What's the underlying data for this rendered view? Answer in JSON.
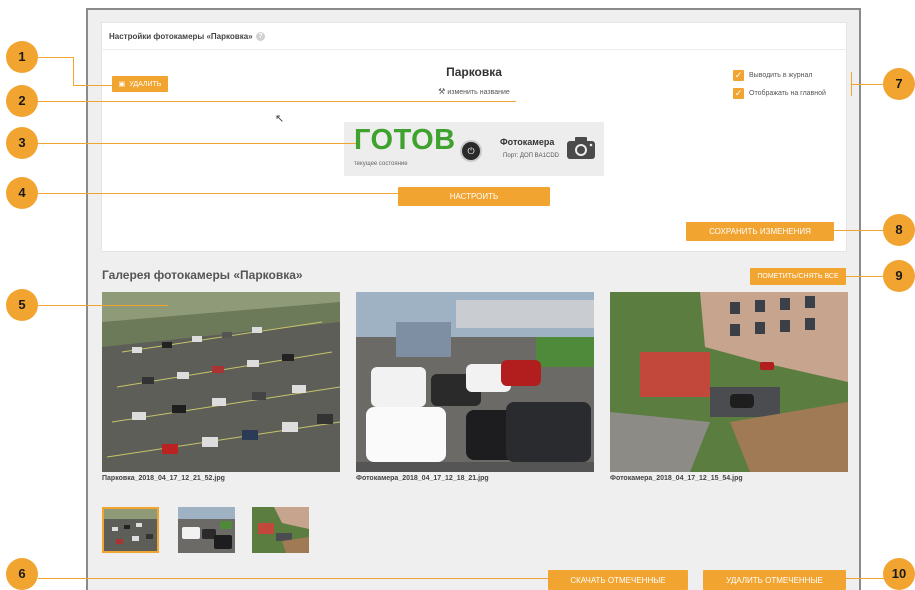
{
  "panel": {
    "title": "Настройки фотокамеры «Парковка»",
    "help": "?"
  },
  "camera": {
    "name": "Парковка",
    "rename_label": "изменить название",
    "delete_label": "УДАЛИТЬ"
  },
  "checkboxes": [
    {
      "label": "Выводить в журнал",
      "checked": true
    },
    {
      "label": "Отображать на главной",
      "checked": true
    }
  ],
  "status": {
    "state": "ГОТОВ",
    "state_caption": "текущее состояние",
    "device_name": "Фотокамера",
    "port": "Порт: ДОП BA1CDD"
  },
  "buttons": {
    "configure": "НАСТРОИТЬ",
    "save": "СОХРАНИТЬ ИЗМЕНЕНИЯ",
    "mark_all": "ПОМЕТИТЬ/СНЯТЬ ВСЕ",
    "download": "СКАЧАТЬ ОТМЕЧЕННЫЕ",
    "delete_marked": "УДАЛИТЬ ОТМЕЧЕННЫЕ"
  },
  "gallery": {
    "title": "Галерея фотокамеры «Парковка»",
    "photos": [
      {
        "filename": "Парковка_2018_04_17_12_21_52.jpg"
      },
      {
        "filename": "Фотокамера_2018_04_17_12_18_21.jpg"
      },
      {
        "filename": "Фотокамера_2018_04_17_12_15_54.jpg"
      }
    ]
  },
  "markers": [
    "1",
    "2",
    "3",
    "4",
    "5",
    "6",
    "7",
    "8",
    "9",
    "10"
  ],
  "colors": {
    "accent": "#f2a431",
    "ready": "#3fa22f"
  }
}
